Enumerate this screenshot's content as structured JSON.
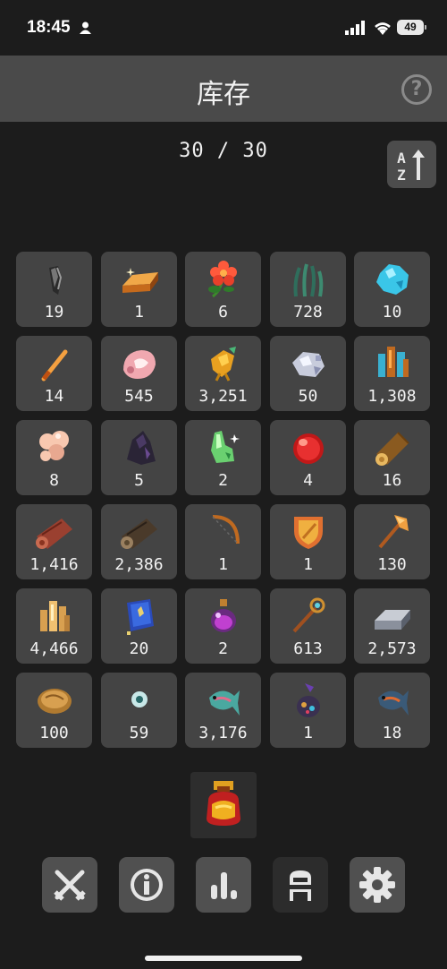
{
  "status": {
    "time": "18:45",
    "battery": "49"
  },
  "header": {
    "title": "库存",
    "help": "?"
  },
  "inventory": {
    "count": "30 / 30",
    "items": [
      {
        "icon": "claw-icon",
        "qty": "19"
      },
      {
        "icon": "gold-bar-icon",
        "qty": "1"
      },
      {
        "icon": "red-flower-icon",
        "qty": "6"
      },
      {
        "icon": "seaweed-icon",
        "qty": "728"
      },
      {
        "icon": "blue-crystal-icon",
        "qty": "10"
      },
      {
        "icon": "feather-icon",
        "qty": "14"
      },
      {
        "icon": "pink-shell-icon",
        "qty": "545"
      },
      {
        "icon": "golden-bird-icon",
        "qty": "3,251"
      },
      {
        "icon": "silver-ore-icon",
        "qty": "50"
      },
      {
        "icon": "crystal-cluster-icon",
        "qty": "1,308"
      },
      {
        "icon": "mushroom-icon",
        "qty": "8"
      },
      {
        "icon": "dark-cloak-icon",
        "qty": "5"
      },
      {
        "icon": "green-gem-icon",
        "qty": "2"
      },
      {
        "icon": "red-orb-icon",
        "qty": "4"
      },
      {
        "icon": "wood-log-icon",
        "qty": "16"
      },
      {
        "icon": "red-log-icon",
        "qty": "1,416"
      },
      {
        "icon": "dark-log-icon",
        "qty": "2,386"
      },
      {
        "icon": "bow-icon",
        "qty": "1"
      },
      {
        "icon": "shield-icon",
        "qty": "1"
      },
      {
        "icon": "axe-icon",
        "qty": "130"
      },
      {
        "icon": "gold-crystals-icon",
        "qty": "4,466"
      },
      {
        "icon": "spellbook-icon",
        "qty": "20"
      },
      {
        "icon": "potion-icon",
        "qty": "2"
      },
      {
        "icon": "wand-icon",
        "qty": "613"
      },
      {
        "icon": "iron-bar-icon",
        "qty": "2,573"
      },
      {
        "icon": "bread-icon",
        "qty": "100"
      },
      {
        "icon": "eye-icon",
        "qty": "59"
      },
      {
        "icon": "fish-icon",
        "qty": "3,176"
      },
      {
        "icon": "pouch-icon",
        "qty": "1"
      },
      {
        "icon": "dark-fish-icon",
        "qty": "18"
      }
    ]
  },
  "equipped": {
    "icon": "bag-icon"
  },
  "nav": [
    "combat-swords-icon",
    "info-icon",
    "stats-bars-icon",
    "inventory-backpack-icon",
    "settings-gear-icon"
  ],
  "colors": {
    "background": "#1c1c1c",
    "header": "#4a4a4a",
    "slot": "#444444"
  }
}
